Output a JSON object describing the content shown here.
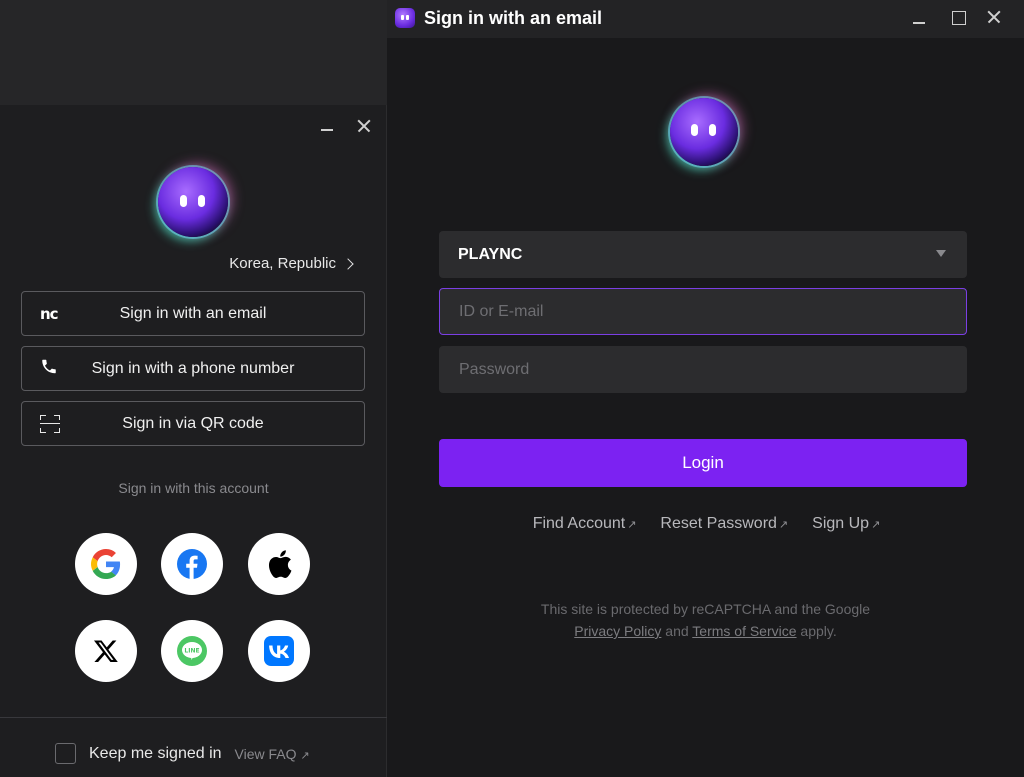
{
  "left_panel": {
    "region_label": "Korea, Republic",
    "options": [
      {
        "label": "Sign in with an email",
        "icon": "nc-logo",
        "icon_text": "nc"
      },
      {
        "label": "Sign in with a phone number",
        "icon": "phone-icon"
      },
      {
        "label": "Sign in via QR code",
        "icon": "qr-code-icon"
      }
    ],
    "account_caption": "Sign in with this account",
    "social_providers": [
      "Google",
      "Facebook",
      "Apple",
      "X",
      "LINE",
      "VK"
    ],
    "keep_signed_in": "Keep me signed in",
    "keep_signed_in_checked": false,
    "view_faq": "View FAQ",
    "ext_arrow": "↗"
  },
  "window": {
    "title": "Sign in with an email",
    "service_select": "PLAYNC",
    "id_placeholder": "ID or E-mail",
    "password_placeholder": "Password",
    "login_label": "Login",
    "links": {
      "find_account": "Find Account",
      "reset_password": "Reset Password",
      "sign_up": "Sign Up",
      "ext_arrow": "↗"
    },
    "legal": {
      "line1": "This site is protected by reCAPTCHA and the Google",
      "privacy": "Privacy Policy",
      "and": "and",
      "terms": "Terms of Service",
      "apply": "apply."
    }
  },
  "colors": {
    "accent": "#7c22f2",
    "focus_border": "#7b3fe4",
    "panel_bg": "#1e1e20",
    "window_bg": "#19191b"
  }
}
